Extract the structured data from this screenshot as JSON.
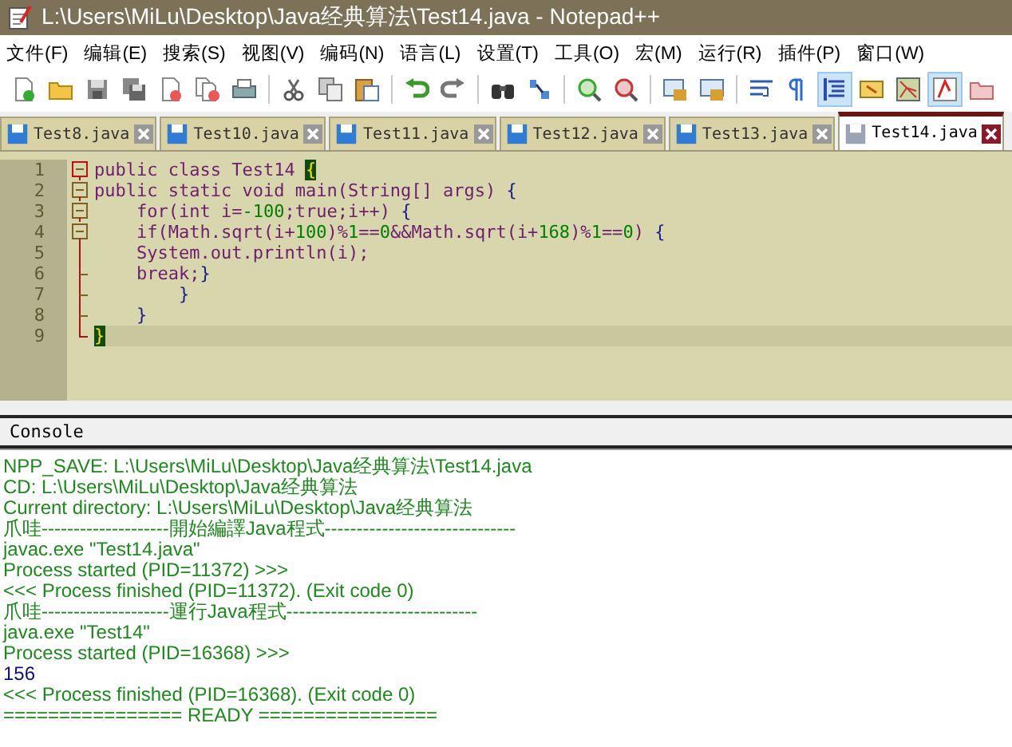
{
  "window": {
    "title": "L:\\Users\\MiLu\\Desktop\\Java经典算法\\Test14.java - Notepad++"
  },
  "menu": [
    "文件(F)",
    "编辑(E)",
    "搜索(S)",
    "视图(V)",
    "编码(N)",
    "语言(L)",
    "设置(T)",
    "工具(O)",
    "宏(M)",
    "运行(R)",
    "插件(P)",
    "窗口(W)"
  ],
  "toolbar": [
    {
      "selected": false
    },
    {
      "selected": false
    },
    {
      "selected": false
    },
    {
      "selected": false
    },
    {
      "selected": false
    },
    {
      "selected": false
    },
    {
      "selected": false
    },
    {
      "selected": false
    },
    {
      "selected": false
    },
    {
      "selected": false
    },
    {
      "selected": false
    },
    {
      "selected": false
    },
    {
      "selected": false
    },
    {
      "selected": false
    },
    {
      "selected": false
    },
    {
      "selected": false
    },
    {
      "selected": false
    },
    {
      "selected": false
    },
    {
      "selected": false
    },
    {
      "selected": false
    },
    {
      "selected": true
    },
    {
      "selected": false
    },
    {
      "selected": false
    },
    {
      "selected": true
    },
    {
      "selected": false
    }
  ],
  "tabs": [
    {
      "label": "Test8.java",
      "selected": false
    },
    {
      "label": "Test10.java",
      "selected": false
    },
    {
      "label": "Test11.java",
      "selected": false
    },
    {
      "label": "Test12.java",
      "selected": false
    },
    {
      "label": "Test13.java",
      "selected": false
    },
    {
      "label": "Test14.java",
      "selected": true
    }
  ],
  "editor": {
    "lines": [
      {
        "number": "1",
        "kind": "box",
        "current": false,
        "segments": [
          {
            "text": "public class Test14 ",
            "kind": "text"
          },
          {
            "text": "{",
            "kind": "match"
          }
        ]
      },
      {
        "number": "2",
        "kind": "box",
        "current": false,
        "segments": [
          {
            "text": "public static void main(String[] args) ",
            "kind": "text"
          },
          {
            "text": "{",
            "kind": "brace"
          }
        ]
      },
      {
        "number": "3",
        "kind": "box",
        "current": false,
        "segments": [
          {
            "text": "    for(int i=",
            "kind": "text"
          },
          {
            "text": "-100",
            "kind": "num"
          },
          {
            "text": ";true;i++) ",
            "kind": "text"
          },
          {
            "text": "{",
            "kind": "brace"
          }
        ]
      },
      {
        "number": "4",
        "kind": "box",
        "current": false,
        "segments": [
          {
            "text": "    if(Math.sqrt(i+",
            "kind": "text"
          },
          {
            "text": "100",
            "kind": "num"
          },
          {
            "text": ")%",
            "kind": "text"
          },
          {
            "text": "1",
            "kind": "num"
          },
          {
            "text": "==",
            "kind": "text"
          },
          {
            "text": "0",
            "kind": "num"
          },
          {
            "text": "&&Math.sqrt(i+",
            "kind": "text"
          },
          {
            "text": "168",
            "kind": "num"
          },
          {
            "text": ")%",
            "kind": "text"
          },
          {
            "text": "1",
            "kind": "num"
          },
          {
            "text": "==",
            "kind": "text"
          },
          {
            "text": "0",
            "kind": "num"
          },
          {
            "text": ") ",
            "kind": "text"
          },
          {
            "text": "{",
            "kind": "brace"
          }
        ]
      },
      {
        "number": "5",
        "kind": "line",
        "current": false,
        "segments": [
          {
            "text": "    System.out.println(i);",
            "kind": "text"
          }
        ]
      },
      {
        "number": "6",
        "kind": "tee",
        "current": false,
        "segments": [
          {
            "text": "    break;",
            "kind": "text"
          },
          {
            "text": "}",
            "kind": "brace"
          }
        ]
      },
      {
        "number": "7",
        "kind": "tee",
        "current": false,
        "segments": [
          {
            "text": "        }",
            "kind": "brace"
          }
        ]
      },
      {
        "number": "8",
        "kind": "tee",
        "current": false,
        "segments": [
          {
            "text": "    }",
            "kind": "brace"
          }
        ]
      },
      {
        "number": "9",
        "kind": "end",
        "current": true,
        "segments": [
          {
            "text": "}",
            "kind": "match"
          }
        ]
      }
    ]
  },
  "console": {
    "title": "Console",
    "lines": [
      {
        "text": "NPP_SAVE: L:\\Users\\MiLu\\Desktop\\Java经典算法\\Test14.java",
        "kind": "info"
      },
      {
        "text": "CD: L:\\Users\\MiLu\\Desktop\\Java经典算法",
        "kind": "info"
      },
      {
        "text": "Current directory: L:\\Users\\MiLu\\Desktop\\Java经典算法",
        "kind": "info"
      },
      {
        "text": "爪哇--------------------開始編譯Java程式------------------------------",
        "kind": "info"
      },
      {
        "text": "javac.exe \"Test14.java\"",
        "kind": "info"
      },
      {
        "text": "Process started (PID=11372) >>>",
        "kind": "info"
      },
      {
        "text": "<<< Process finished (PID=11372). (Exit code 0)",
        "kind": "info"
      },
      {
        "text": "爪哇--------------------運行Java程式------------------------------",
        "kind": "info"
      },
      {
        "text": "java.exe \"Test14\"",
        "kind": "info"
      },
      {
        "text": "Process started (PID=16368) >>>",
        "kind": "info"
      },
      {
        "text": "156",
        "kind": "output"
      },
      {
        "text": "<<< Process finished (PID=16368). (Exit code 0)",
        "kind": "info"
      },
      {
        "text": "================ READY ================",
        "kind": "info"
      }
    ]
  }
}
